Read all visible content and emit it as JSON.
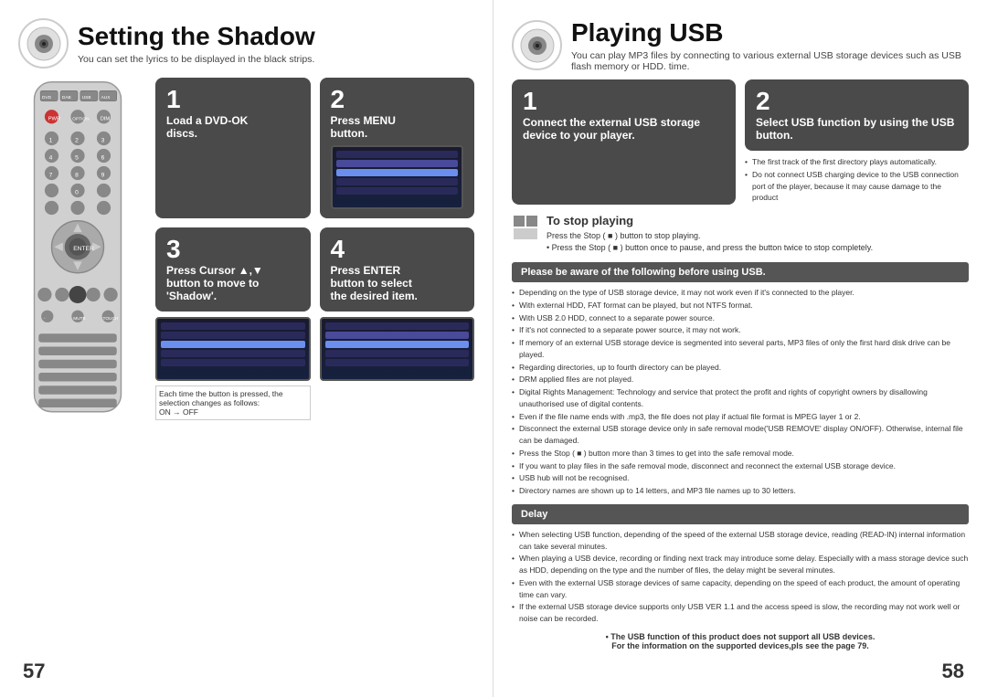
{
  "left_page": {
    "title": "Setting the Shadow",
    "subtitle": "You can set the lyrics to be displayed in the black strips.",
    "page_number": "57",
    "steps": [
      {
        "number": "1",
        "line1": "Load a DVD-OK",
        "line2": "discs."
      },
      {
        "number": "2",
        "line1": "Press ",
        "bold": "MENU",
        "line2": "button."
      },
      {
        "number": "3",
        "line1": "Press Cursor ▲,▼",
        "line2": "button to move to",
        "line3": "'Shadow'."
      },
      {
        "number": "4",
        "line1": "Press ",
        "bold": "ENTER",
        "line2": "button to select",
        "line3": "the desired item."
      }
    ],
    "step3_note": "Each time the button is pressed, the selection changes as follows:\nON → OFF"
  },
  "right_page": {
    "title": "Playing USB",
    "subtitle": "You can play MP3 files by connecting to various external USB storage devices such as USB flash memory or HDD. time.",
    "page_number": "58",
    "step1": {
      "number": "1",
      "text": "Connect the external USB storage device to your player."
    },
    "step2": {
      "number": "2",
      "text": "Select USB function by using the USB button."
    },
    "step2_notes": [
      "The first track of the first directory plays automatically.",
      "Do not connect USB charging device to the USB connection port of the player, because it may cause damage to the product"
    ],
    "stop_playing": {
      "title": "To stop playing",
      "lines": [
        "Press the Stop (  ) button to stop playing.",
        "Press the Stop (  ) button once to pause, and press the button twice to stop completely."
      ]
    },
    "warning_title": "Please be aware of the following before using USB.",
    "warning_items": [
      "Depending on the type of USB storage device, it may not work even if it's connected to the player.",
      "With external HDD, FAT format can be played, but not NTFS format.",
      "With USB 2.0 HDD, connect to a separate power source.",
      "If it's not connected to a separate power source, it may not work.",
      "If memory of an external USB storage device is segmented into several parts, MP3 files of only the first hard disk drive can be played.",
      "Regarding directories, up to fourth directory can be played.",
      "DRM applied files are not played.",
      "Digital Rights Management: Technology and service that protect the profit and rights of copyright owners by disallowing unauthorised use of digital contents.",
      "Even if the file name ends with .mp3, the file does not play if actual file format is MPEG layer 1 or 2.",
      "Disconnect the external USB storage device only in safe removal mode('USB REMOVE' display ON/OFF). Otherwise, internal file can be damaged.",
      "Press the Stop (  ) button more than 3 times to get into the safe removal mode.",
      "If you want to play files in the safe removal mode, disconnect and reconnect the external USB storage device.",
      "USB hub will not be recognised.",
      "Directory names are shown up to 14 letters, and MP3 file names up to 30 letters."
    ],
    "delay_title": "Delay",
    "delay_items": [
      "When selecting USB function, depending of the speed of the external USB storage device, reading (READ-IN) internal information can take several minutes.",
      "When playing a USB device, recording or finding next track may introduce some delay. Especially with a mass storage device such as HDD, depending on the type and the number of files, the delay might be several minutes.",
      "Even with the external USB storage devices of same capacity, depending on the speed of each product, the amount of operating time can vary.",
      "If the external USB storage device supports only USB VER 1.1 and the access speed is slow, the recording may not work well or noise can be recorded."
    ],
    "bottom_note1": "• The USB function  of this product does not support all USB devices.",
    "bottom_note2": "For the information  on the supported devices,pls see the page 79."
  }
}
